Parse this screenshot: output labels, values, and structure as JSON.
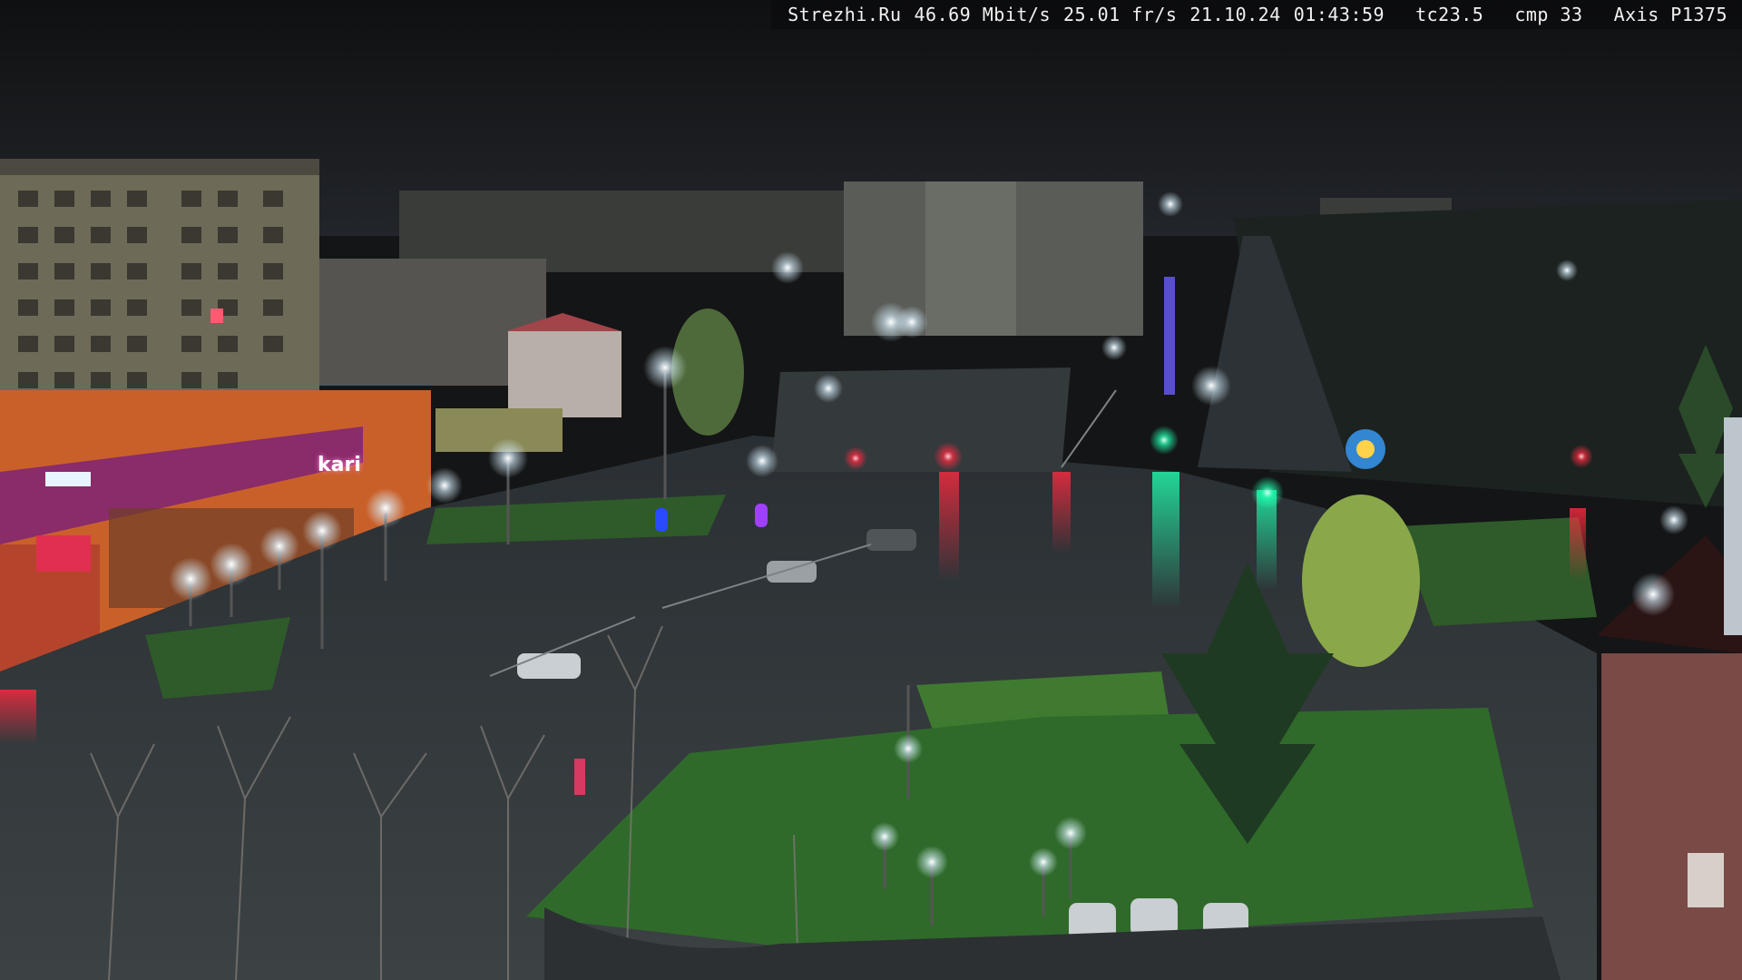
{
  "overlay": {
    "site": "Strezhi.Ru",
    "bitrate": "46.69 Mbit/s",
    "framerate": "25.01 fr/s",
    "date": "21.10.24",
    "time": "01:43:59",
    "tc": "tc23.5",
    "cmp": "cmp 33",
    "camera_model": "Axis P1375"
  },
  "signs": {
    "store": "kari"
  },
  "scene": {
    "description_tags": [
      "night-street-camera",
      "wet-asphalt",
      "city-square",
      "street-lights",
      "traffic-lights"
    ],
    "colors": {
      "sky": "#141516",
      "asphalt": "#3a3e40",
      "grass": "#2f5a2a",
      "lamp_glow": "#e8f6ff",
      "traffic_red": "#ff2a40",
      "traffic_green": "#20ffb0",
      "store_front": "#c9602a",
      "store_band": "#8a2b6a"
    }
  }
}
